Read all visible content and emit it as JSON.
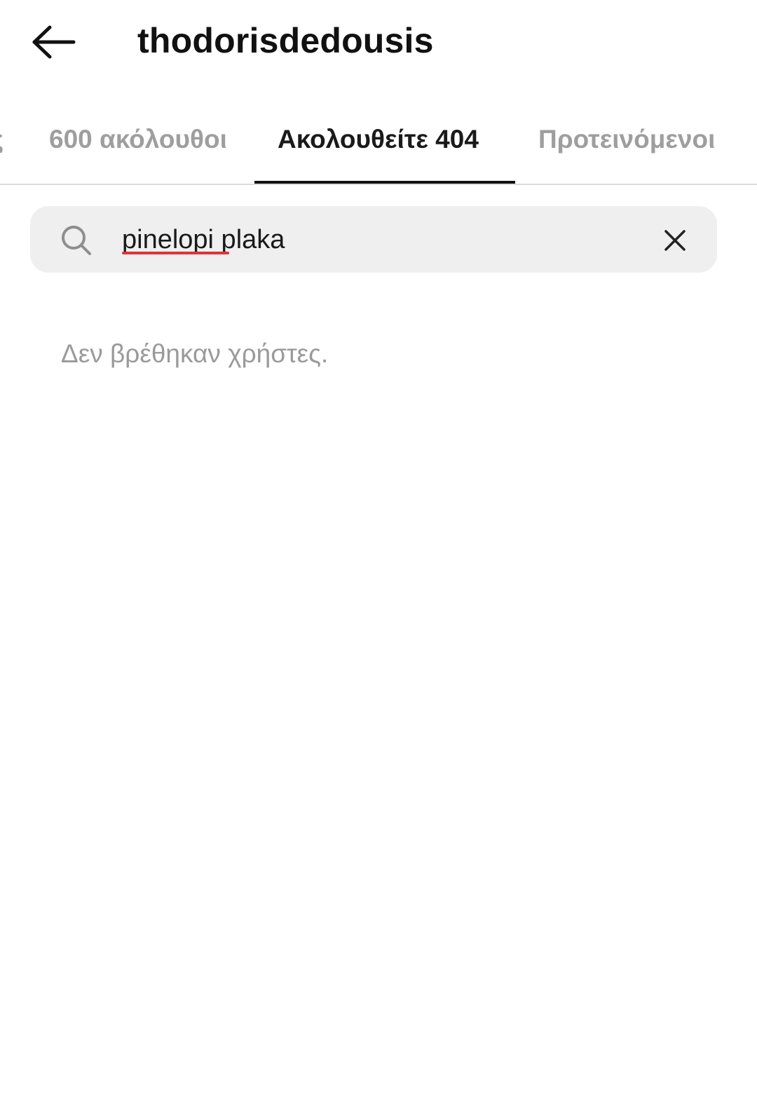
{
  "header": {
    "username": "thodorisdedousis",
    "back_icon": "arrow-left-icon"
  },
  "tabs": [
    {
      "label": "ς",
      "selected": false
    },
    {
      "label": "600 ακόλουθοι",
      "selected": false
    },
    {
      "label": "Ακολουθείτε 404",
      "selected": true
    },
    {
      "label": "Προτεινόμενοι",
      "selected": false
    }
  ],
  "search": {
    "icon": "search-icon",
    "value": "pinelopi plaka",
    "clear_icon": "close-icon"
  },
  "results": {
    "empty_message": "Δεν βρέθηκαν χρήστες."
  },
  "colors": {
    "text_primary": "#111111",
    "text_muted": "#9e9e9e",
    "search_bg": "#efefef",
    "spell_underline": "#e0323c",
    "divider": "#dbdbdb"
  }
}
